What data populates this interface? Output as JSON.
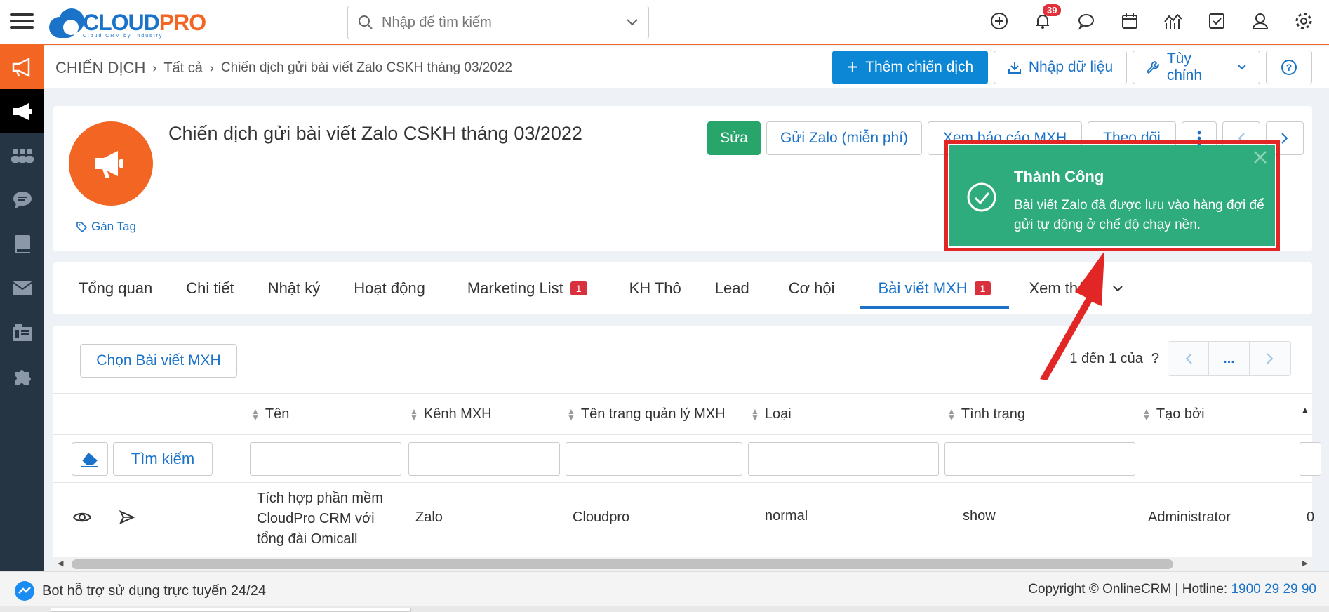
{
  "app": {
    "logo_text_cloud": "CLOUD",
    "logo_text_pro": "PRO",
    "logo_tagline": "Cloud CRM by Industry",
    "accent": "#f26522",
    "brand_blue": "#1a73c9"
  },
  "search": {
    "placeholder": "Nhập để tìm kiếm"
  },
  "notifications": {
    "count": "39"
  },
  "breadcrumb": {
    "root": "CHIẾN DỊCH",
    "level1": "Tất cả",
    "current": "Chiến dịch gửi bài viết Zalo CSKH tháng 03/2022"
  },
  "header_actions": {
    "add": "Thêm chiến dịch",
    "import": "Nhập dữ liệu",
    "customize": "Tùy chỉnh",
    "help": "?"
  },
  "record": {
    "title": "Chiến dịch gửi bài viết Zalo CSKH tháng 03/2022",
    "tag_label": "Gán Tag",
    "actions": {
      "edit": "Sửa",
      "send_zalo": "Gửi Zalo (miễn phí)",
      "view_report": "Xem báo cáo MXH",
      "follow": "Theo dõi"
    }
  },
  "tabs": [
    {
      "label": "Tổng quan"
    },
    {
      "label": "Chi tiết"
    },
    {
      "label": "Nhật ký"
    },
    {
      "label": "Hoạt động"
    },
    {
      "label": "Marketing List",
      "count": "1"
    },
    {
      "label": "KH Thô"
    },
    {
      "label": "Lead"
    },
    {
      "label": "Cơ hội"
    },
    {
      "label": "Bài viết MXH",
      "count": "1",
      "active": true
    },
    {
      "label": "Xem thêm"
    }
  ],
  "list": {
    "choose_button": "Chọn Bài viết MXH",
    "pager_text": "1 đến 1 của",
    "pager_unknown": "?",
    "pager_more": "...",
    "search_button": "Tìm kiếm",
    "columns": [
      "Tên",
      "Kênh MXH",
      "Tên trang quản lý MXH",
      "Loại",
      "Tình trạng",
      "Tạo bởi"
    ],
    "rows": [
      {
        "name_l1": "Tích hợp phần mềm",
        "name_l2": "CloudPro CRM với",
        "name_l3": "tổng đài Omicall",
        "channel": "Zalo",
        "page": "Cloudpro",
        "type": "normal",
        "status": "show",
        "created_by": "Administrator",
        "overflow": "0"
      }
    ]
  },
  "toast": {
    "title": "Thành Công",
    "message": "Bài viết Zalo đã được lưu vào hàng đợi để gửi tự động ở chế độ chạy nền.",
    "color": "#2fac7d"
  },
  "footer": {
    "bot": "Bot hỗ trợ sử dụng trực tuyến 24/24",
    "copyright": "Copyright © OnlineCRM | Hotline: ",
    "hotline": "1900 29 29 90"
  }
}
